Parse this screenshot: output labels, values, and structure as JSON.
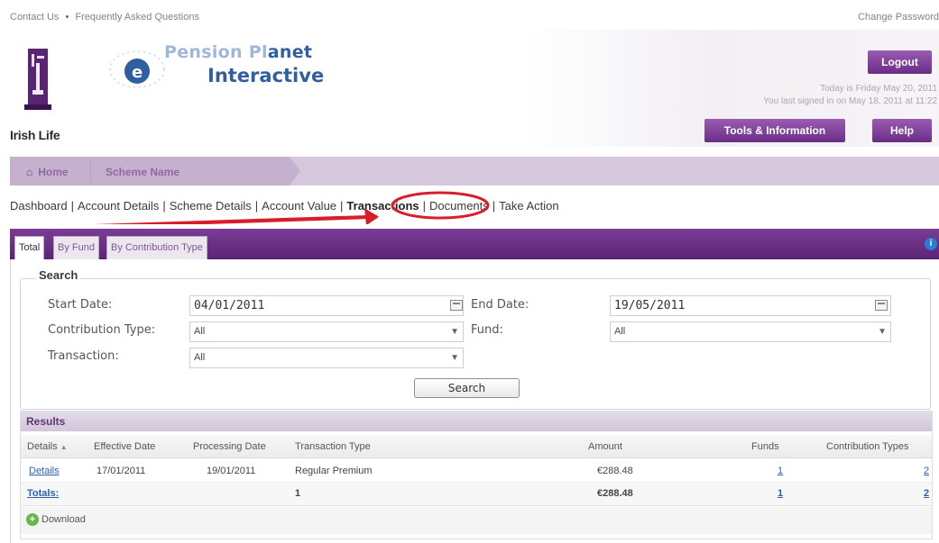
{
  "top_links": {
    "contact": "Contact Us",
    "bullet": "•",
    "faq": "Frequently Asked Questions",
    "change_password": "Change Password"
  },
  "brand": {
    "irish_life": "Irish Life",
    "pp_part1": "Pension Pl",
    "pp_part2": "anet",
    "pp_interactive": "Interactive"
  },
  "header": {
    "logout": "Logout",
    "today": "Today is Friday May 20, 2011",
    "last_signed": "You last signed in on May 18, 2011 at 11:22",
    "tools": "Tools & Information",
    "help": "Help"
  },
  "breadcrumb": {
    "home": "Home",
    "scheme": "Scheme Name"
  },
  "subnav": [
    "Dashboard",
    "Account Details",
    "Scheme Details",
    "Account Value",
    "Transactions",
    "Documents",
    "Take Action"
  ],
  "subnav_active": "Transactions",
  "tabs": [
    "Total",
    "By Fund",
    "By Contribution Type"
  ],
  "search": {
    "legend": "Search",
    "start_label": "Start Date:",
    "start_value": "04/01/2011",
    "end_label": "End Date:",
    "end_value": "19/05/2011",
    "contrib_label": "Contribution Type:",
    "contrib_value": "All",
    "fund_label": "Fund:",
    "fund_value": "All",
    "txn_label": "Transaction:",
    "txn_value": "All",
    "button": "Search"
  },
  "results": {
    "title": "Results",
    "columns": [
      "Details",
      "Effective Date",
      "Processing Date",
      "Transaction Type",
      "Amount",
      "Funds",
      "Contribution Types"
    ],
    "sort_indicator": "▲",
    "rows": [
      {
        "details": "Details",
        "effective": "17/01/2011",
        "processing": "19/01/2011",
        "type": "Regular Premium",
        "amount": "€288.48",
        "funds": "1",
        "ctypes": "2"
      }
    ],
    "totals": {
      "label": "Totals:",
      "count": "1",
      "amount": "€288.48",
      "funds": "1",
      "ctypes": "2"
    },
    "download": "Download"
  },
  "colors": {
    "purple_dark": "#5a2474",
    "purple_button": "#7b3c95",
    "link_blue": "#2a5fb0",
    "annotation_red": "#d81e2c"
  }
}
